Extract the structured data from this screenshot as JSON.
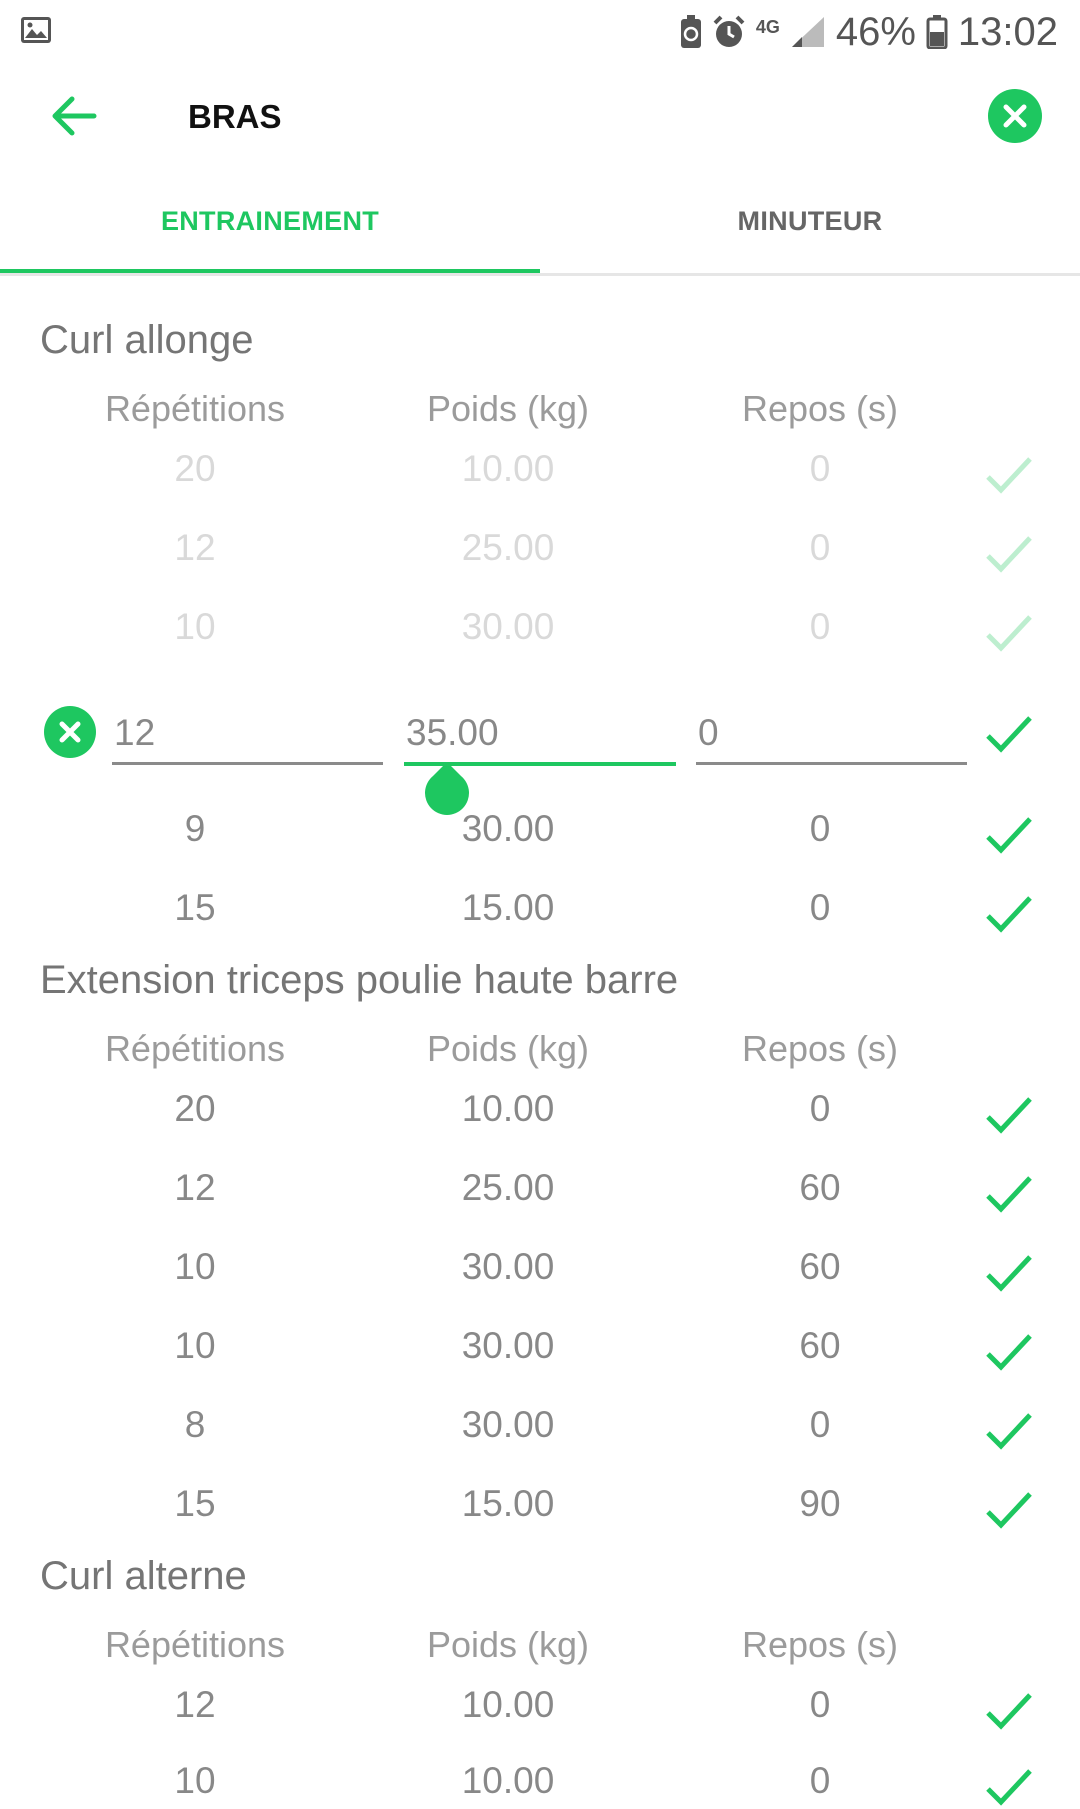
{
  "status": {
    "network": "4G",
    "battery": "46%",
    "time": "13:02"
  },
  "appbar": {
    "title": "BRAS"
  },
  "tabs": [
    {
      "label": "ENTRAINEMENT"
    },
    {
      "label": "MINUTEUR"
    }
  ],
  "colors": {
    "accent": "#1ec760"
  },
  "headers": {
    "reps": "Répétitions",
    "weight": "Poids (kg)",
    "rest": "Repos (s)"
  },
  "exercises": [
    {
      "name": "Curl allonge",
      "done_sets": [
        {
          "reps": "20",
          "weight": "10.00",
          "rest": "0"
        },
        {
          "reps": "12",
          "weight": "25.00",
          "rest": "0"
        },
        {
          "reps": "10",
          "weight": "30.00",
          "rest": "0"
        }
      ],
      "editing_set": {
        "reps": "12",
        "weight": "35.00",
        "rest": "0"
      },
      "pending_sets": [
        {
          "reps": "9",
          "weight": "30.00",
          "rest": "0"
        },
        {
          "reps": "15",
          "weight": "15.00",
          "rest": "0"
        }
      ]
    },
    {
      "name": "Extension triceps poulie haute barre",
      "sets": [
        {
          "reps": "20",
          "weight": "10.00",
          "rest": "0"
        },
        {
          "reps": "12",
          "weight": "25.00",
          "rest": "60"
        },
        {
          "reps": "10",
          "weight": "30.00",
          "rest": "60"
        },
        {
          "reps": "10",
          "weight": "30.00",
          "rest": "60"
        },
        {
          "reps": "8",
          "weight": "30.00",
          "rest": "0"
        },
        {
          "reps": "15",
          "weight": "15.00",
          "rest": "90"
        }
      ]
    },
    {
      "name": "Curl alterne",
      "sets": [
        {
          "reps": "12",
          "weight": "10.00",
          "rest": "0"
        },
        {
          "reps": "10",
          "weight": "10.00",
          "rest": "0"
        }
      ]
    }
  ]
}
